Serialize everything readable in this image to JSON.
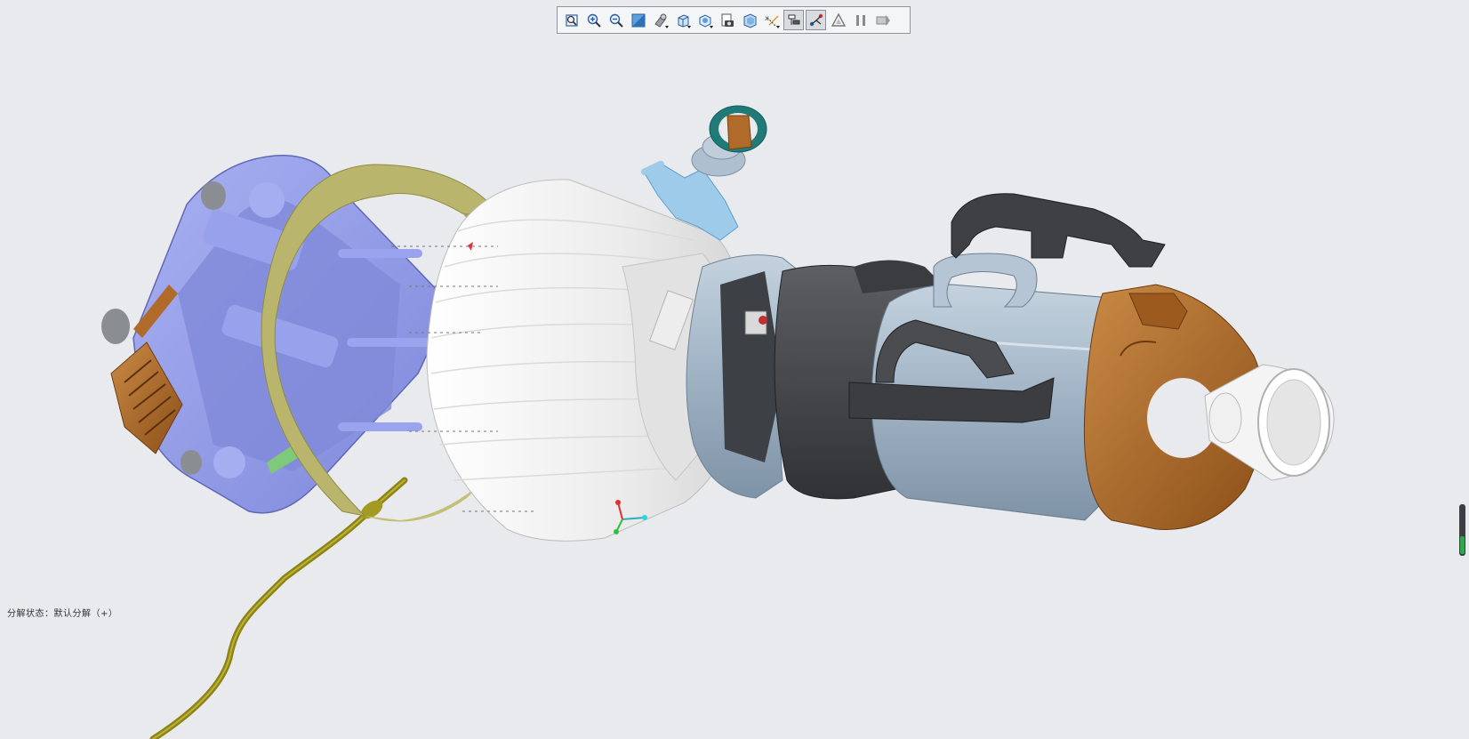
{
  "toolbar": {
    "buttons": [
      {
        "name": "zoom-fit-button",
        "icon": "zoom-fit-icon"
      },
      {
        "name": "zoom-in-button",
        "icon": "zoom-in-icon"
      },
      {
        "name": "zoom-out-button",
        "icon": "zoom-out-icon"
      },
      {
        "name": "section-button",
        "icon": "section-icon"
      },
      {
        "name": "display-style-button",
        "icon": "display-style-icon",
        "dropdown": true
      },
      {
        "name": "named-view-button",
        "icon": "view-cube-icon",
        "dropdown": true
      },
      {
        "name": "view-orientation-button",
        "icon": "orientation-icon",
        "dropdown": true
      },
      {
        "name": "snapshot-button",
        "icon": "camera-icon"
      },
      {
        "name": "perspective-button",
        "icon": "perspective-icon"
      },
      {
        "name": "datum-display-button",
        "icon": "datum-icon",
        "dropdown": true
      },
      {
        "name": "explode-view-button",
        "icon": "explode-icon",
        "active": true
      },
      {
        "name": "offset-lines-button",
        "icon": "offset-lines-icon",
        "active": true
      },
      {
        "name": "annotation-button",
        "icon": "triangle-icon"
      },
      {
        "name": "pause-button",
        "icon": "pause-icon"
      },
      {
        "name": "spin-center-button",
        "icon": "spin-center-icon"
      }
    ]
  },
  "status": {
    "text": "分解状态：默认分解（+）"
  },
  "colors": {
    "background": "#e9eaed",
    "blue_part": "#8f9ae8",
    "olive_band": "#b8b46a",
    "white_housing": "#f2f2f2",
    "dark_part": "#4a4c50",
    "steel_part": "#a8b8c8",
    "bronze_part": "#b06a2a",
    "teal_part": "#1f7a78",
    "cable": "#9a8f15"
  },
  "zoom_indicator": {
    "level": 0.35
  }
}
